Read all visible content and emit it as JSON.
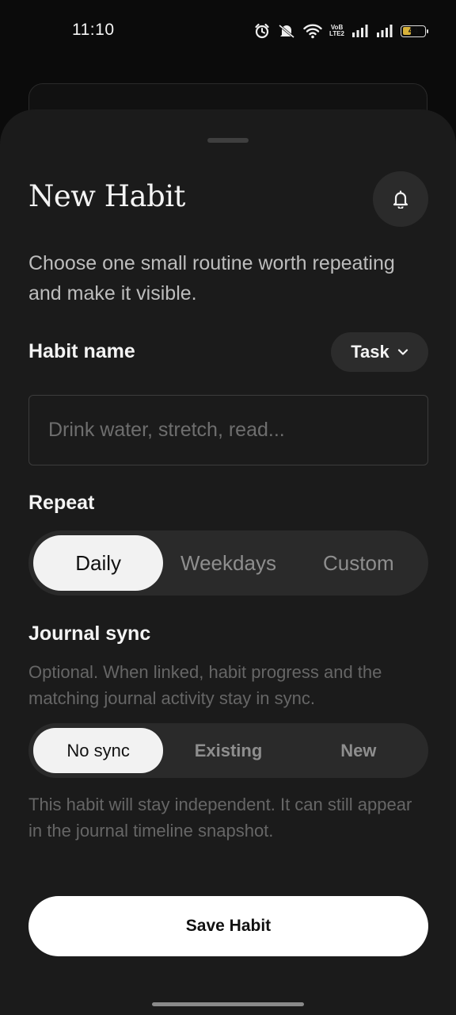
{
  "status_bar": {
    "time": "11:10",
    "network_label_top": "VoB",
    "network_label_bottom": "LTE2",
    "battery_percent": "44",
    "battery_level": 0.44,
    "battery_color": "#d8b23a",
    "icons": [
      "alarm-icon",
      "mute-icon",
      "wifi-icon",
      "volte-icon",
      "signal-icon",
      "signal-icon",
      "battery-icon"
    ]
  },
  "sheet": {
    "title": "New Habit",
    "bell_icon": "bell-icon",
    "intro": "Choose one small routine worth repeating and make it visible.",
    "habit_name": {
      "label": "Habit name",
      "type_selector": "Task",
      "placeholder": "Drink water, stretch, read...",
      "value": ""
    },
    "repeat": {
      "label": "Repeat",
      "options": [
        "Daily",
        "Weekdays",
        "Custom"
      ],
      "selected": "Daily"
    },
    "journal_sync": {
      "label": "Journal sync",
      "description": "Optional. When linked, habit progress and the matching journal activity stay in sync.",
      "options": [
        "No sync",
        "Existing",
        "New"
      ],
      "selected": "No sync",
      "note": "This habit will stay independent. It can still appear in the journal timeline snapshot."
    },
    "save_label": "Save Habit"
  },
  "colors": {
    "sheet_bg": "#1b1b1b",
    "accent": "#f2f2f2",
    "muted_text": "#666666"
  }
}
